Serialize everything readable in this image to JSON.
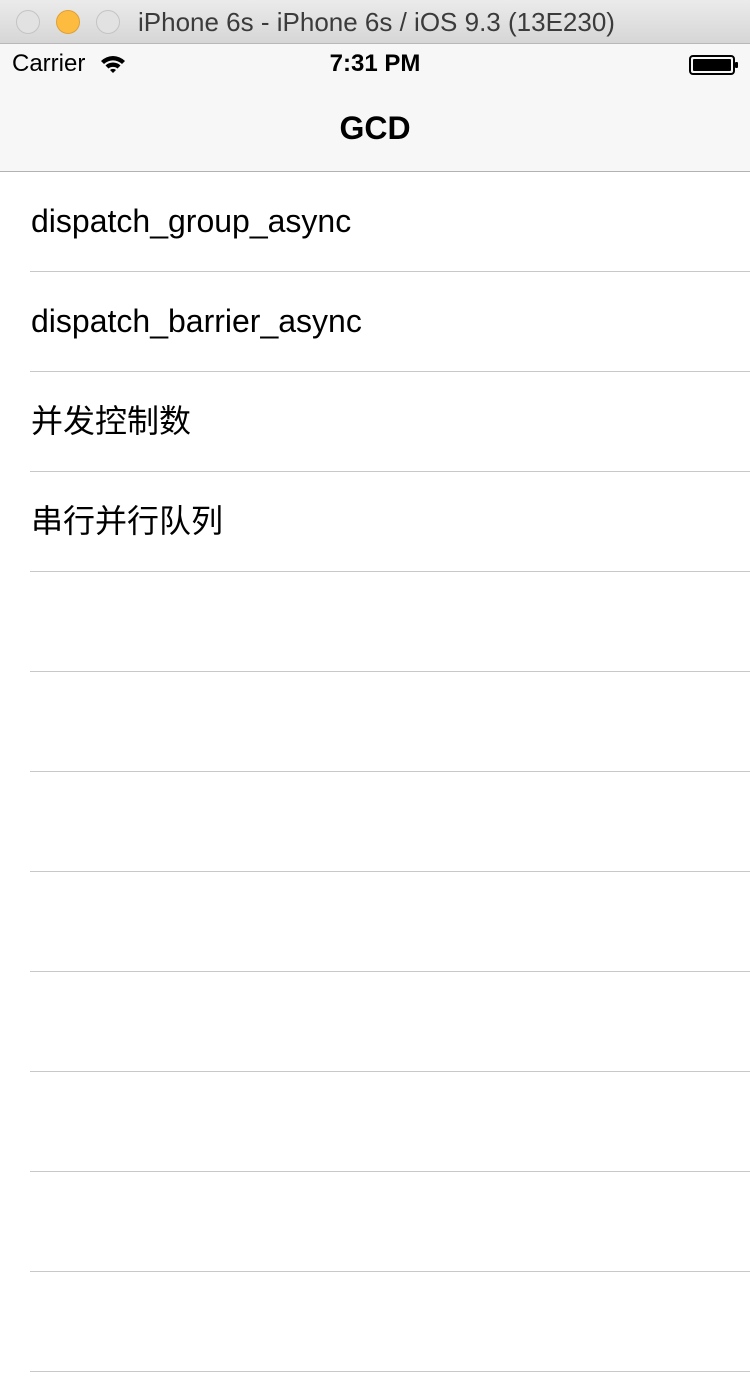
{
  "window": {
    "title": "iPhone 6s - iPhone 6s / iOS 9.3 (13E230)"
  },
  "status_bar": {
    "carrier": "Carrier",
    "time": "7:31 PM",
    "wifi_icon": "wifi-icon",
    "battery_icon": "battery-full-icon"
  },
  "nav_bar": {
    "title": "GCD"
  },
  "table": {
    "rows": [
      {
        "label": "dispatch_group_async"
      },
      {
        "label": "dispatch_barrier_async"
      },
      {
        "label": "并发控制数"
      },
      {
        "label": "串行并行队列"
      },
      {
        "label": ""
      },
      {
        "label": ""
      },
      {
        "label": ""
      },
      {
        "label": ""
      },
      {
        "label": ""
      },
      {
        "label": ""
      },
      {
        "label": ""
      },
      {
        "label": ""
      }
    ]
  }
}
